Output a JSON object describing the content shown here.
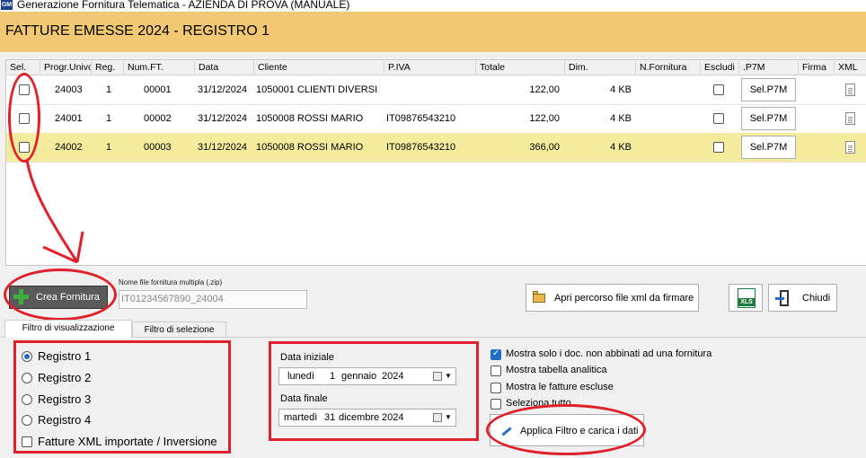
{
  "window": {
    "title": "Generazione Fornitura Telematica - AZIENDA DI PROVA (MANUALE)",
    "icon_text": "GM"
  },
  "header": {
    "title": "FATTURE EMESSE 2024 - REGISTRO 1"
  },
  "grid": {
    "columns": [
      "Sel.",
      "Progr.Univo",
      "Reg.",
      "Num.FT.",
      "Data",
      "Cliente",
      "P.IVA",
      "Totale",
      "Dim.",
      "N.Fornitura",
      "Escludi",
      ".P7M",
      "Firma",
      "XML"
    ],
    "rows": [
      {
        "progr": "24003",
        "reg": "1",
        "num": "00001",
        "data": "31/12/2024",
        "cliente": "1050001 CLIENTI DIVERSI",
        "piva": "",
        "totale": "122,00",
        "dim": "4 KB",
        "p7m_label": "Sel.P7M",
        "selected": false
      },
      {
        "progr": "24001",
        "reg": "1",
        "num": "00002",
        "data": "31/12/2024",
        "cliente": "1050008 ROSSI MARIO",
        "piva": "IT09876543210",
        "totale": "122,00",
        "dim": "4 KB",
        "p7m_label": "Sel.P7M",
        "selected": false
      },
      {
        "progr": "24002",
        "reg": "1",
        "num": "00003",
        "data": "31/12/2024",
        "cliente": "1050008 ROSSI MARIO",
        "piva": "IT09876543210",
        "totale": "366,00",
        "dim": "4 KB",
        "p7m_label": "Sel.P7M",
        "selected": true
      }
    ]
  },
  "toolbar": {
    "crea_label": "Crea Fornitura",
    "nome_file_label": "Nome file fornitura multipla (.zip)",
    "nome_file_value": "IT01234567890_24004",
    "apri_label": "Apri percorso file xml da firmare",
    "xls_label": "XLS",
    "chiudi_label": "Chiudi"
  },
  "tabs": [
    "Filtro di visualizzazione",
    "Filtro di selezione"
  ],
  "filter": {
    "registri": [
      {
        "label": "Registro 1",
        "checked": true
      },
      {
        "label": "Registro 2",
        "checked": false
      },
      {
        "label": "Registro 3",
        "checked": false
      },
      {
        "label": "Registro 4",
        "checked": false
      }
    ],
    "importate_label": "Fatture XML importate / Inversione",
    "data_iniziale_label": "Data iniziale",
    "data_iniziale": {
      "day": "lunedì",
      "num": "1",
      "month": "gennaio",
      "year": "2024"
    },
    "data_finale_label": "Data finale",
    "data_finale": {
      "day": "martedì",
      "num": "31",
      "month": "dicembre",
      "year": "2024"
    },
    "options": [
      {
        "label": "Mostra solo i doc. non abbinati ad una fornitura",
        "checked": true
      },
      {
        "label": "Mostra tabella analitica",
        "checked": false
      },
      {
        "label": "Mostra le fatture escluse",
        "checked": false
      },
      {
        "label": "Seleziona tutto",
        "checked": false
      }
    ],
    "applica_label": "Applica Filtro e carica i dati"
  },
  "colors": {
    "header_bg": "#f3c872",
    "selected_row": "#f4ec9c",
    "annotation_red": "#e0202a",
    "accent_blue": "#1f6fc6"
  }
}
